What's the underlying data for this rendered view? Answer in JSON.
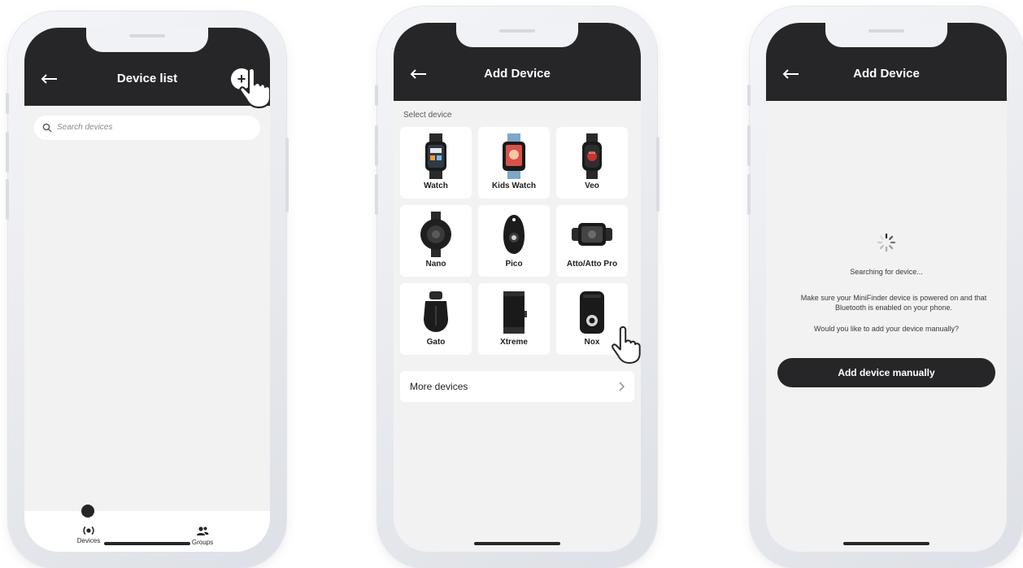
{
  "screen1": {
    "title": "Device list",
    "plus_label": "+",
    "search_placeholder": "Search devices",
    "tabs": [
      {
        "label": "Devices",
        "icon": "radio-waves-icon",
        "active": true
      },
      {
        "label": "Groups",
        "icon": "groups-icon",
        "active": false
      }
    ]
  },
  "screen2": {
    "title": "Add Device",
    "section_label": "Select device",
    "devices": [
      {
        "name": "Watch",
        "icon": "smartwatch-icon"
      },
      {
        "name": "Kids Watch",
        "icon": "kids-watch-icon"
      },
      {
        "name": "Veo",
        "icon": "sos-watch-icon"
      },
      {
        "name": "Nano",
        "icon": "round-tracker-icon"
      },
      {
        "name": "Pico",
        "icon": "teardrop-tracker-icon"
      },
      {
        "name": "Atto/Atto Pro",
        "icon": "strap-tracker-icon"
      },
      {
        "name": "Gato",
        "icon": "pet-tracker-icon"
      },
      {
        "name": "Xtreme",
        "icon": "box-tracker-icon"
      },
      {
        "name": "Nox",
        "icon": "handheld-tracker-icon"
      }
    ],
    "more_label": "More devices"
  },
  "screen3": {
    "title": "Add Device",
    "status": "Searching for device...",
    "hint": "Make sure your MiniFinder device is powered on and that Bluetooth is enabled on your phone.",
    "question": "Would you like to add your device manually?",
    "button_label": "Add device manually"
  },
  "colors": {
    "header": "#262628",
    "background": "#f2f2f2",
    "card": "#ffffff",
    "frame": "#e6e8ec"
  }
}
